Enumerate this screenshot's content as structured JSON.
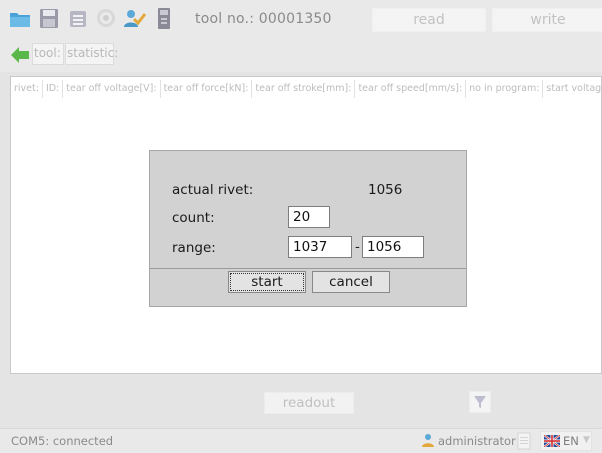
{
  "toolbar": {
    "tool_no_label": "tool no.:",
    "tool_no_value": "00001350",
    "read_label": "read",
    "write_label": "write",
    "icons": [
      "folder-open-icon",
      "save-icon",
      "list-icon",
      "gear-icon",
      "user-icon",
      "device-icon"
    ]
  },
  "subbar": {
    "tool_label": "tool:",
    "statistic_label": "statistic:"
  },
  "table": {
    "columns": [
      "rivet:",
      "ID:",
      "tear off voltage[V]:",
      "tear off force[kN]:",
      "tear off stroke[mm]:",
      "tear off speed[mm/s]:",
      "no in program:",
      "start voltage[V]:"
    ]
  },
  "dialog": {
    "actual_rivet_label": "actual rivet:",
    "actual_rivet_value": "1056",
    "count_label": "count:",
    "count_value": "20",
    "range_label": "range:",
    "range_from": "1037",
    "range_separator": "-",
    "range_to": "1056",
    "start_label": "start",
    "cancel_label": "cancel"
  },
  "bottom": {
    "readout_label": "readout"
  },
  "status": {
    "connection": "COM5: connected",
    "user": "administrator",
    "language": "EN"
  },
  "colors": {
    "background": "#e4e4e4",
    "dialog": "#d2d2d2",
    "accent_green": "#5ab84a",
    "accent_blue": "#4aa3d8"
  }
}
